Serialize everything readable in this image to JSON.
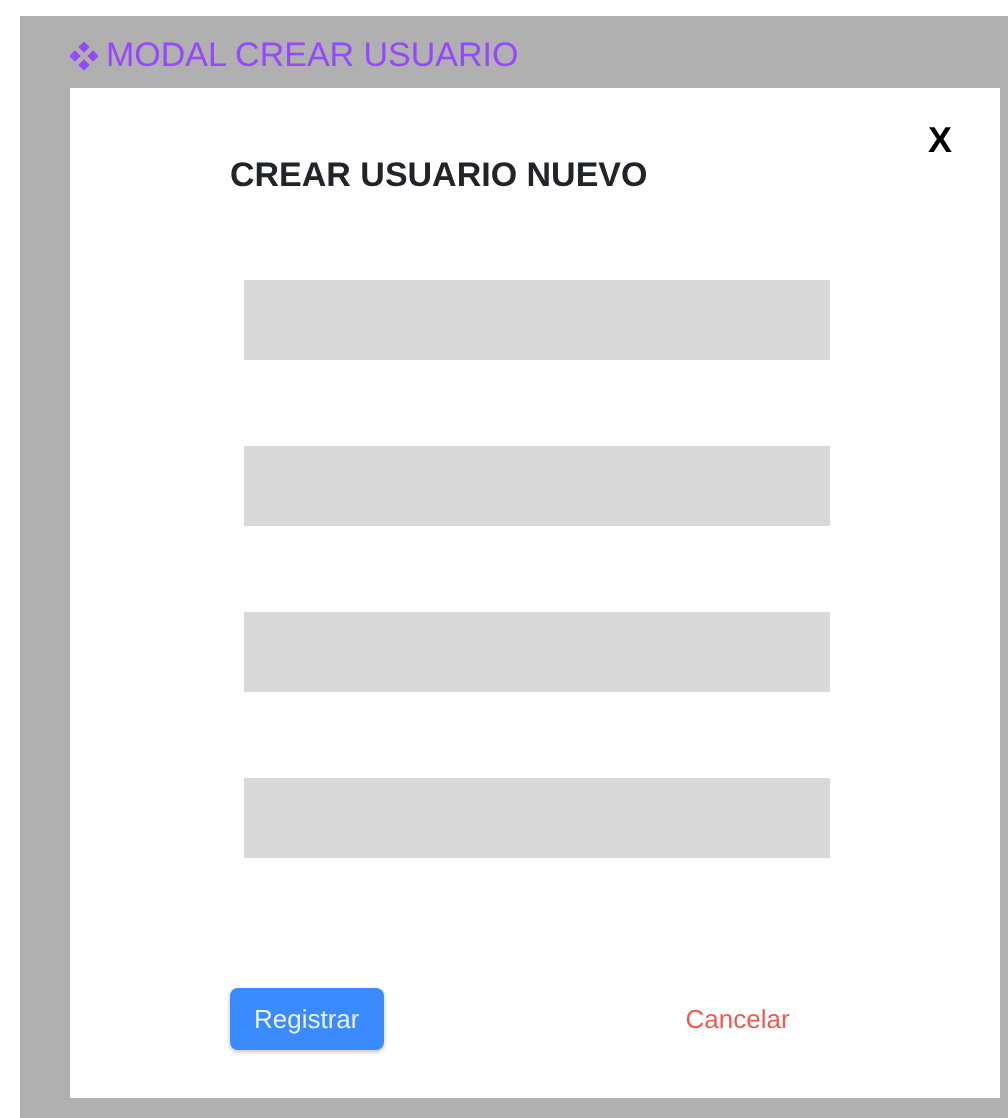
{
  "frame": {
    "title": "MODAL CREAR USUARIO"
  },
  "modal": {
    "close": "X",
    "heading": "CREAR USUARIO NUEVO",
    "fields": [
      {
        "kind": "input"
      },
      {
        "kind": "input"
      },
      {
        "kind": "input"
      },
      {
        "kind": "input"
      }
    ],
    "buttons": [
      {
        "label": "Registrar",
        "kind": "primary"
      },
      {
        "label": "Cancelar",
        "kind": "link"
      }
    ]
  }
}
